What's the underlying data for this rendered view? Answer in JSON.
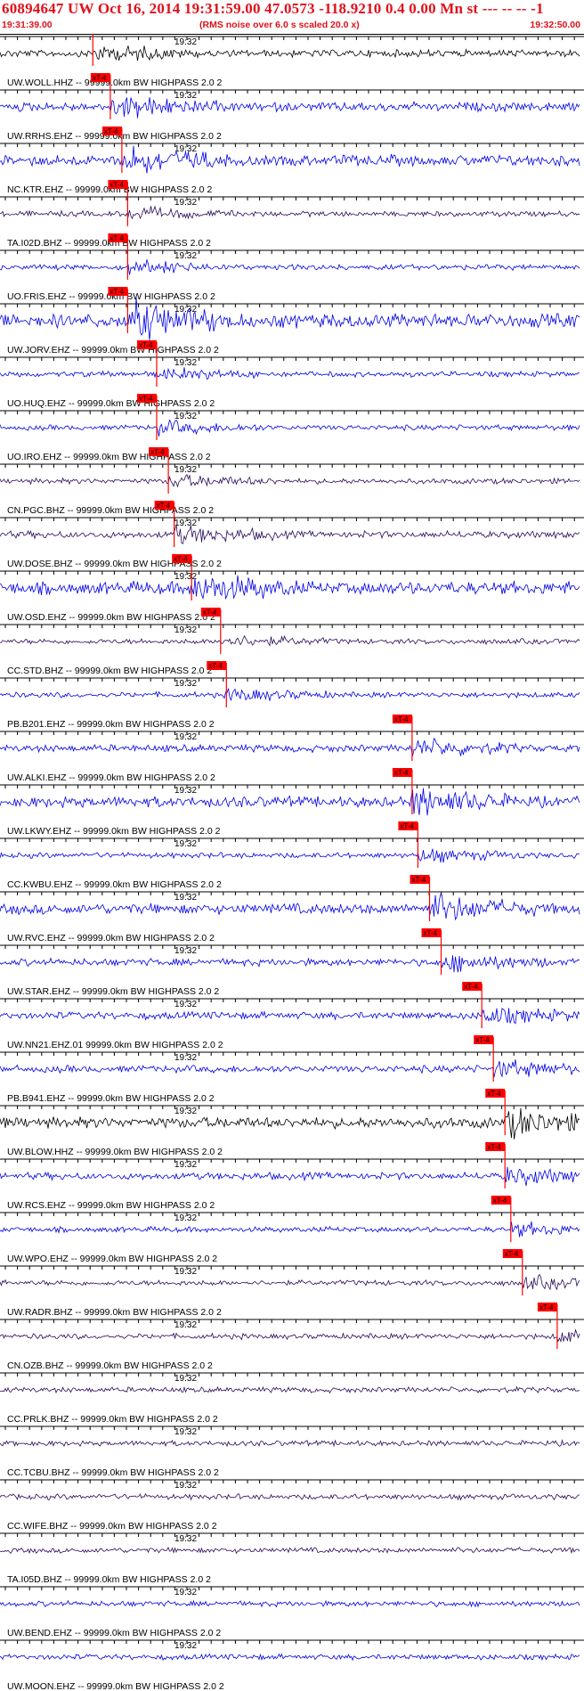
{
  "header": {
    "title": "60894647 UW Oct 16, 2014 19:31:59.00   47.0573 -118.9210  0.4 0.00 Mn st --- -- --   -1",
    "start_time": "19:31:39.00",
    "end_time": "19:32:50.00",
    "note": "(RMS noise over 6.0 s scaled 20.0 x)"
  },
  "time_tick_label": "19:32",
  "pick_label": "xT-4",
  "colors": {
    "title": "#e0101a",
    "pick": "#ff0000",
    "trace_blue": "#0000e6",
    "trace_dark": "#2a0a5a",
    "trace_black": "#000000"
  },
  "traces": [
    {
      "label": "UW.WOLL.HHZ -- 99999.0km BW  HIGHPASS  2.0  2",
      "color": "black",
      "amp": 4,
      "pick": 0.16
    },
    {
      "label": "UW.RRHS.EHZ -- 99999.0km BW  HIGHPASS  2.0  2",
      "color": "blue",
      "amp": 5,
      "pick": 0.19
    },
    {
      "label": "NC.KTR.EHZ -- 99999.0km BW  HIGHPASS  2.0  2",
      "color": "blue",
      "amp": 6,
      "pick": 0.21
    },
    {
      "label": "TA.I02D.BHZ -- 99999.0km BW  HIGHPASS  2.0  2",
      "color": "dark",
      "amp": 3,
      "pick": 0.22
    },
    {
      "label": "UO.FRIS.EHZ -- 99999.0km BW  HIGHPASS  2.0  2",
      "color": "blue",
      "amp": 3,
      "pick": 0.22
    },
    {
      "label": "UW.JORV.EHZ -- 99999.0km BW  HIGHPASS  2.0  2",
      "color": "blue",
      "amp": 8,
      "pick": 0.22
    },
    {
      "label": "UO.HUQ.EHZ -- 99999.0km BW  HIGHPASS  2.0  2",
      "color": "blue",
      "amp": 3,
      "pick": 0.27
    },
    {
      "label": "UO.IRO.EHZ -- 99999.0km BW  HIGHPASS  2.0  2",
      "color": "blue",
      "amp": 3,
      "pick": 0.27
    },
    {
      "label": "CN.PGC.BHZ -- 99999.0km BW  HIGHPASS  2.0  2",
      "color": "dark",
      "amp": 3,
      "pick": 0.29
    },
    {
      "label": "UW.DOSE.BHZ -- 99999.0km BW  HIGHPASS  2.0  2",
      "color": "dark",
      "amp": 4,
      "pick": 0.3
    },
    {
      "label": "UW.OSD.EHZ -- 99999.0km BW  HIGHPASS  2.0  2",
      "color": "blue",
      "amp": 7,
      "pick": 0.33
    },
    {
      "label": "CC.STD.BHZ -- 99999.0km BW  HIGHPASS  2.0  2",
      "color": "dark",
      "amp": 3,
      "pick": 0.38
    },
    {
      "label": "PB.B201.EHZ -- 99999.0km BW  HIGHPASS  2.0  2",
      "color": "blue",
      "amp": 3,
      "pick": 0.39
    },
    {
      "label": "UW.ALKI.EHZ -- 99999.0km BW  HIGHPASS  2.0  2",
      "color": "blue",
      "amp": 4,
      "pick": 0.71
    },
    {
      "label": "UW.LKWY.EHZ -- 99999.0km BW  HIGHPASS  2.0  2",
      "color": "blue",
      "amp": 6,
      "pick": 0.71
    },
    {
      "label": "CC.KWBU.EHZ -- 99999.0km BW  HIGHPASS  2.0  2",
      "color": "blue",
      "amp": 3,
      "pick": 0.72
    },
    {
      "label": "UW.RVC.EHZ -- 99999.0km BW  HIGHPASS  2.0  2",
      "color": "blue",
      "amp": 6,
      "pick": 0.74
    },
    {
      "label": "UW.STAR.EHZ -- 99999.0km BW  HIGHPASS  2.0  2",
      "color": "blue",
      "amp": 4,
      "pick": 0.76
    },
    {
      "label": "UW.NN21.EHZ.01 99999.0km BW  HIGHPASS  2.0  2",
      "color": "blue",
      "amp": 4,
      "pick": 0.83
    },
    {
      "label": "PB.B941.EHZ -- 99999.0km BW  HIGHPASS  2.0  2",
      "color": "blue",
      "amp": 4,
      "pick": 0.85
    },
    {
      "label": "UW.BLOW.HHZ -- 99999.0km BW  HIGHPASS  2.0  2",
      "color": "black",
      "amp": 6,
      "pick": 0.87
    },
    {
      "label": "UW.RCS.EHZ -- 99999.0km BW  HIGHPASS  2.0  2",
      "color": "blue",
      "amp": 4,
      "pick": 0.87
    },
    {
      "label": "UW.WPO.EHZ -- 99999.0km BW  HIGHPASS  2.0  2",
      "color": "blue",
      "amp": 3,
      "pick": 0.88
    },
    {
      "label": "UW.RADR.BHZ -- 99999.0km BW  HIGHPASS  2.0  2",
      "color": "dark",
      "amp": 3,
      "pick": 0.9
    },
    {
      "label": "CN.OZB.BHZ -- 99999.0km BW  HIGHPASS  2.0  2",
      "color": "dark",
      "amp": 3,
      "pick": 0.96
    },
    {
      "label": "CC.PRLK.BHZ -- 99999.0km BW  HIGHPASS  2.0  2",
      "color": "dark",
      "amp": 3,
      "pick": null
    },
    {
      "label": "CC.TCBU.BHZ -- 99999.0km BW  HIGHPASS  2.0  2",
      "color": "dark",
      "amp": 3,
      "pick": null
    },
    {
      "label": "CC.WIFE.BHZ -- 99999.0km BW  HIGHPASS  2.0  2",
      "color": "dark",
      "amp": 3,
      "pick": null
    },
    {
      "label": "TA.I05D.BHZ -- 99999.0km BW  HIGHPASS  2.0  2",
      "color": "dark",
      "amp": 3,
      "pick": null
    },
    {
      "label": "UW.BEND.EHZ -- 99999.0km BW  HIGHPASS  2.0  2",
      "color": "blue",
      "amp": 3,
      "pick": null
    },
    {
      "label": "UW.MOON.EHZ -- 99999.0km BW  HIGHPASS  2.0  2",
      "color": "blue",
      "amp": 3,
      "pick": null
    }
  ]
}
